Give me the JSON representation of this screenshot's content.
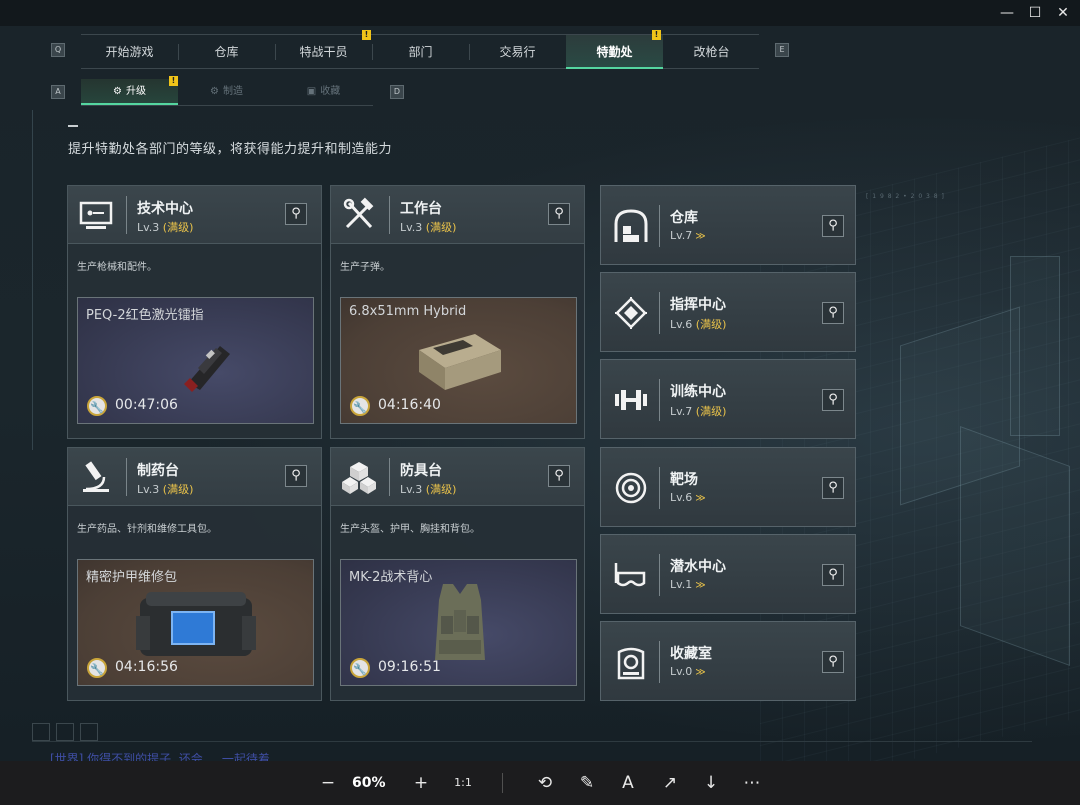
{
  "window": {
    "minimize": "—",
    "maximize": "☐",
    "close": "✕"
  },
  "key_hints": {
    "prev_tab": "Q",
    "next_tab": "E",
    "prev_sub": "A",
    "next_sub": "D"
  },
  "tabs": [
    {
      "label": "开始游戏",
      "active": false,
      "alert": false
    },
    {
      "label": "仓库",
      "active": false,
      "alert": false
    },
    {
      "label": "特战干员",
      "active": false,
      "alert": true
    },
    {
      "label": "部门",
      "active": false,
      "alert": false
    },
    {
      "label": "交易行",
      "active": false,
      "alert": false
    },
    {
      "label": "特勤处",
      "active": true,
      "alert": true
    },
    {
      "label": "改枪台",
      "active": false,
      "alert": false
    }
  ],
  "alert_mark": "!",
  "subtabs": [
    {
      "label": "升级",
      "icon": "upgrade-icon",
      "active": true,
      "alert": true
    },
    {
      "label": "制造",
      "icon": "craft-icon",
      "active": false,
      "alert": false
    },
    {
      "label": "收藏",
      "icon": "collection-icon",
      "active": false,
      "alert": false
    }
  ],
  "page_description": "提升特勤处各部门的等级，将获得能力提升和制造能力",
  "coord_deco": "[ 1 9 8 2  •  2 0 3 8 ]",
  "facilities": [
    {
      "title": "技术中心",
      "level": "Lv.3",
      "maxed_label": "(满级)",
      "icon": "computer-icon",
      "description": "生产枪械和配件。",
      "product": {
        "name": "PEQ-2红色激光镭指",
        "time": "00:47:06",
        "bg": "purple"
      }
    },
    {
      "title": "工作台",
      "level": "Lv.3",
      "maxed_label": "(满级)",
      "icon": "tools-icon",
      "description": "生产子弹。",
      "product": {
        "name": "6.8x51mm Hybrid",
        "time": "04:16:40",
        "bg": "brown"
      }
    },
    {
      "title": "制药台",
      "level": "Lv.3",
      "maxed_label": "(满级)",
      "icon": "microscope-icon",
      "description": "生产药品、针剂和维修工具包。",
      "product": {
        "name": "精密护甲维修包",
        "time": "04:16:56",
        "bg": "brown"
      }
    },
    {
      "title": "防具台",
      "level": "Lv.3",
      "maxed_label": "(满级)",
      "icon": "cubes-icon",
      "description": "生产头盔、护甲、胸挂和背包。",
      "product": {
        "name": "MK-2战术背心",
        "time": "09:16:51",
        "bg": "purple"
      }
    }
  ],
  "side_facilities": [
    {
      "title": "仓库",
      "level": "Lv.7",
      "maxed_label": "",
      "chevron": "≫",
      "icon": "storage-icon"
    },
    {
      "title": "指挥中心",
      "level": "Lv.6",
      "maxed_label": "(满级)",
      "chevron": "",
      "icon": "chip-icon"
    },
    {
      "title": "训练中心",
      "level": "Lv.7",
      "maxed_label": "(满级)",
      "chevron": "",
      "icon": "dumbbell-icon"
    },
    {
      "title": "靶场",
      "level": "Lv.6",
      "maxed_label": "",
      "chevron": "≫",
      "icon": "target-icon"
    },
    {
      "title": "潜水中心",
      "level": "Lv.1",
      "maxed_label": "",
      "chevron": "≫",
      "icon": "goggles-icon"
    },
    {
      "title": "收藏室",
      "level": "Lv.0",
      "maxed_label": "",
      "chevron": "≫",
      "icon": "trophy-icon"
    }
  ],
  "chat_line": "[世界] 你得不到的提子, 还会 ... 一起待着",
  "viewer": {
    "zoom": "60%",
    "zoom_out": "−",
    "zoom_in": "+",
    "actual_size": "1:1",
    "rotate": "⟲",
    "edit": "✎",
    "text_select": "A",
    "share": "↗",
    "download": "↓",
    "more": "⋯"
  },
  "colors": {
    "accent": "#55d6a0",
    "gold": "#e9c24a",
    "alert": "#f0c419"
  }
}
